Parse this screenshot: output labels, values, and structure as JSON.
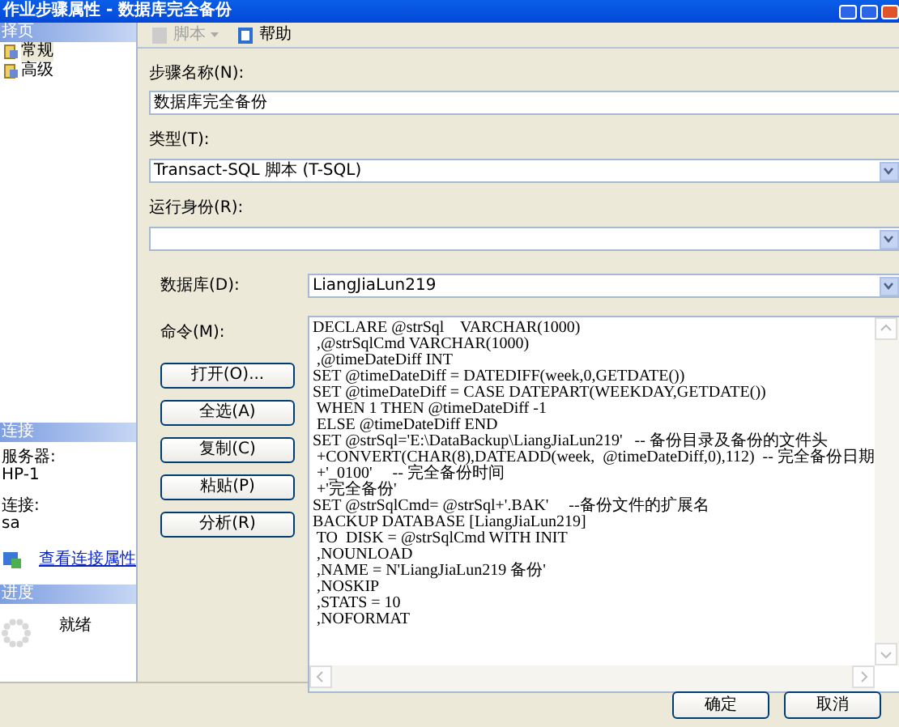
{
  "window": {
    "title": "作业步骤属性 - 数据库完全备份"
  },
  "sidebar": {
    "pages_header": "择页",
    "pages": [
      {
        "label": "常规",
        "selected": true
      },
      {
        "label": "高级",
        "selected": false
      }
    ],
    "connection_header": "连接",
    "server_label": "服务器:",
    "server_value": "HP-1",
    "connection_label": "连接:",
    "connection_value": "sa",
    "link": "查看连接属性",
    "progress_header": "进度",
    "progress_status": "就绪"
  },
  "toolbar": [
    {
      "label": "脚本",
      "disabled": true,
      "dropdown": true
    },
    {
      "label": "帮助",
      "disabled": false,
      "dropdown": false
    }
  ],
  "form": {
    "step_name_label": "步骤名称(N):",
    "step_name_value": "数据库完全备份",
    "type_label": "类型(T):",
    "type_value": "Transact-SQL 脚本 (T-SQL)",
    "run_as_label": "运行身份(R):",
    "database_label": "数据库(D):",
    "database_value": "LiangJiaLun219",
    "command_label": "命令(M):",
    "command_buttons": [
      "打开(O)...",
      "全选(A)",
      "复制(C)",
      "粘贴(P)",
      "分析(R)"
    ],
    "command_lines": [
      "DECLARE @strSql    VARCHAR(1000)",
      " ,@strSqlCmd VARCHAR(1000)",
      " ,@timeDateDiff INT",
      "SET @timeDateDiff = DATEDIFF(week,0,GETDATE())",
      "SET @timeDateDiff = CASE DATEPART(WEEKDAY,GETDATE())",
      " WHEN 1 THEN @timeDateDiff -1",
      " ELSE @timeDateDiff END",
      "SET @strSql='E:\\DataBackup\\LiangJiaLun219'   -- 备份目录及备份的文件头",
      " +CONVERT(CHAR(8),DATEADD(week,  @timeDateDiff,0),112)  -- 完全备份日期",
      " +'_0100'     -- 完全备份时间",
      " +'完全备份'",
      "SET @strSqlCmd= @strSql+'.BAK'     --备份文件的扩展名",
      "BACKUP DATABASE [LiangJiaLun219]",
      " TO  DISK = @strSqlCmd WITH INIT",
      " ,NOUNLOAD",
      " ,NAME = N'LiangJiaLun219 备份'",
      " ,NOSKIP",
      " ,STATS = 10",
      " ,NOFORMAT"
    ]
  },
  "buttons": [
    "确定",
    "取消"
  ]
}
